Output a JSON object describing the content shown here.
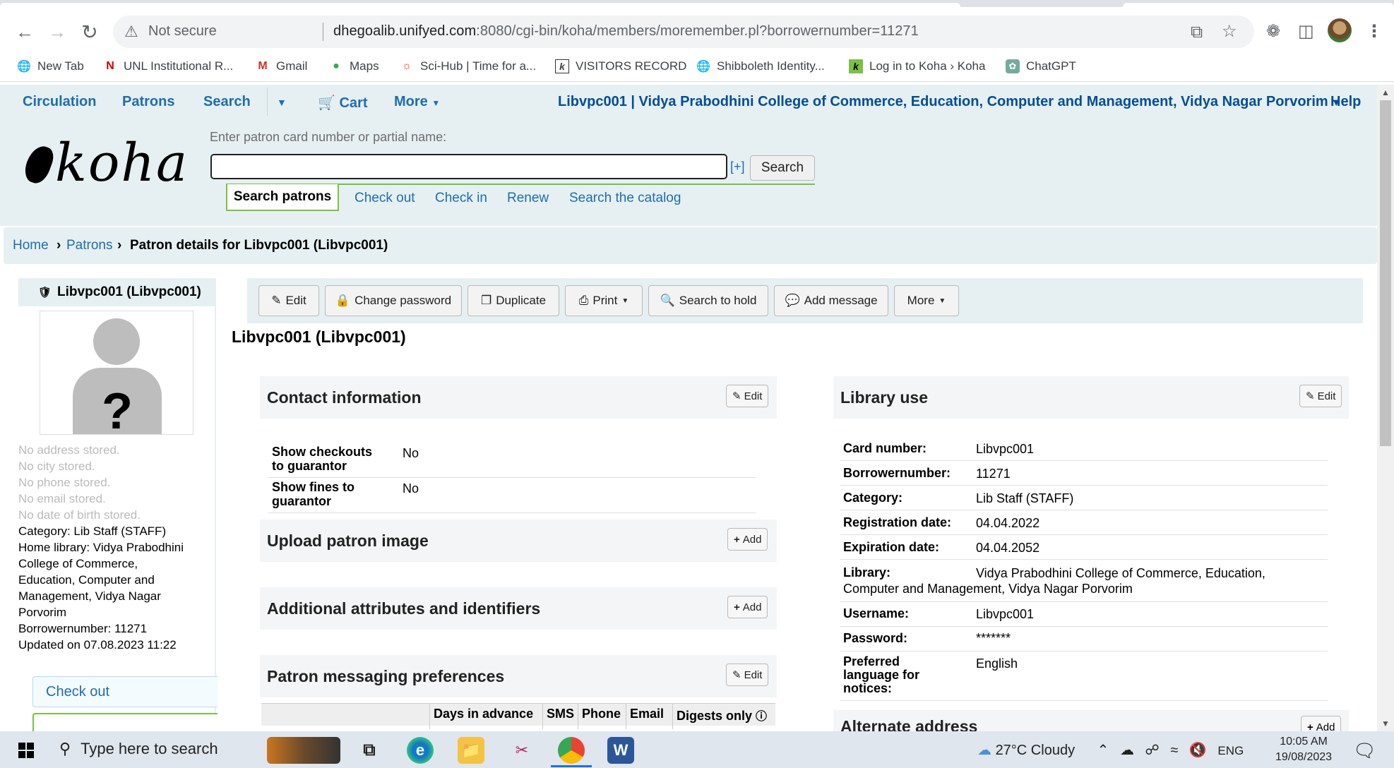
{
  "browser": {
    "url_warning": "Not secure",
    "url_host": "dhegoalib.unifyed.com",
    "url_rest": ":8080/cgi-bin/koha/members/moremember.pl?borrowernumber=11271"
  },
  "bookmarks": [
    {
      "label": "New Tab",
      "icon": "globe-icon"
    },
    {
      "label": "UNL Institutional R...",
      "icon": "unl-icon"
    },
    {
      "label": "Gmail",
      "icon": "gmail-icon"
    },
    {
      "label": "Maps",
      "icon": "maps-icon"
    },
    {
      "label": "Sci-Hub | Time for a...",
      "icon": "scihub-icon"
    },
    {
      "label": "VISITORS RECORD",
      "icon": "koha-icon"
    },
    {
      "label": "Shibboleth Identity...",
      "icon": "globe-icon"
    },
    {
      "label": "Log in to Koha › Koha",
      "icon": "koha-icon"
    },
    {
      "label": "ChatGPT",
      "icon": "chatgpt-icon"
    }
  ],
  "nav": {
    "circulation": "Circulation",
    "patrons": "Patrons",
    "search": "Search",
    "cart": "Cart",
    "more": "More",
    "library": "Libvpc001  |  Vidya Prabodhini College of Commerce, Education, Computer and Management, Vidya Nagar Porvorim",
    "help": "Help"
  },
  "header": {
    "logo_text": "koha",
    "search_label": "Enter patron card number or partial name:",
    "search_value": "",
    "plus": "[+]",
    "search_button": "Search",
    "tabs": {
      "search_patrons": "Search patrons",
      "check_out": "Check out",
      "check_in": "Check in",
      "renew": "Renew",
      "search_catalog": "Search the catalog"
    }
  },
  "breadcrumb": {
    "home": "Home",
    "patrons": "Patrons",
    "current": "Patron details for Libvpc001 (Libvpc001)"
  },
  "sidebar": {
    "title": "Libvpc001 (Libvpc001)",
    "no_address": "No address stored.",
    "no_city": "No city stored.",
    "no_phone": "No phone stored.",
    "no_email": "No email stored.",
    "no_dob": "No date of birth stored.",
    "category": "Category: Lib Staff (STAFF)",
    "home_library": [
      "Home library: Vidya Prabodhini",
      "College of Commerce,",
      "Education, Computer and",
      "Management, Vidya Nagar",
      "Porvorim"
    ],
    "borrowernumber": "Borrowernumber: 11271",
    "updated": "Updated on 07.08.2023 11:22",
    "checkout": "Check out"
  },
  "actions": {
    "edit": "Edit",
    "change_password": "Change password",
    "duplicate": "Duplicate",
    "print": "Print",
    "search_to_hold": "Search to hold",
    "add_message": "Add message",
    "more": "More"
  },
  "page_title": "Libvpc001 (Libvpc001)",
  "contact": {
    "title": "Contact information",
    "edit": "Edit",
    "rows": [
      {
        "label1": "Show checkouts",
        "label2": "to guarantor",
        "value": "No"
      },
      {
        "label1": "Show fines to",
        "label2": "guarantor",
        "value": "No"
      }
    ]
  },
  "upload": {
    "title": "Upload patron image",
    "add": "Add"
  },
  "attributes": {
    "title": "Additional attributes and identifiers",
    "add": "Add"
  },
  "messaging": {
    "title": "Patron messaging preferences",
    "edit": "Edit",
    "columns": [
      "Days in advance",
      "SMS",
      "Phone",
      "Email",
      "Digests only"
    ]
  },
  "library_use": {
    "title": "Library use",
    "edit": "Edit",
    "card_number_label": "Card number:",
    "card_number": "Libvpc001",
    "borrowernumber_label": "Borrowernumber:",
    "borrowernumber": "11271",
    "category_label": "Category:",
    "category": "Lib Staff (STAFF)",
    "registration_label": "Registration date:",
    "registration": "04.04.2022",
    "expiration_label": "Expiration date:",
    "expiration": "04.04.2052",
    "library_label": "Library:",
    "library_line1": "Vidya Prabodhini College of Commerce, Education,",
    "library_line2": "Computer and Management, Vidya Nagar Porvorim",
    "username_label": "Username:",
    "username": "Libvpc001",
    "password_label": "Password:",
    "password": "*******",
    "lang_label": [
      "Preferred",
      "language for",
      "notices:"
    ],
    "lang": "English"
  },
  "alternate": {
    "title": "Alternate address",
    "add": "Add"
  },
  "taskbar": {
    "search_placeholder": "Type here to search",
    "weather": "27°C  Cloudy",
    "lang": "ENG",
    "time": "10:05 AM",
    "date": "19/08/2023"
  }
}
